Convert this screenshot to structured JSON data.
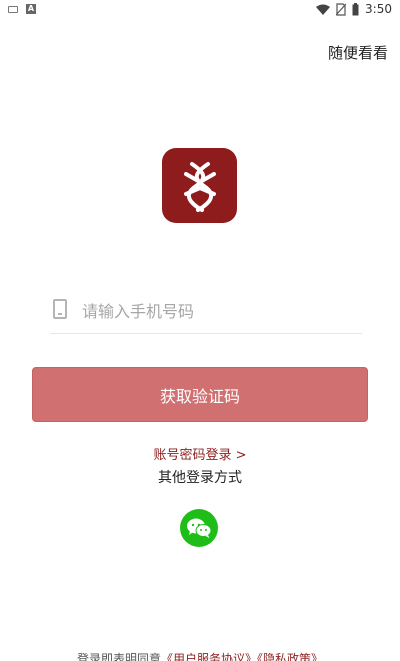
{
  "status_bar": {
    "time": "3:50",
    "icons": [
      "keyboard-icon",
      "a-icon",
      "wifi-icon",
      "no-sim-icon",
      "battery-icon"
    ],
    "a_glyph": "A"
  },
  "header": {
    "browse_link": "随便看看"
  },
  "logo": {
    "brand_color": "#8e1c1c"
  },
  "phone": {
    "placeholder": "请输入手机号码",
    "value": ""
  },
  "buttons": {
    "get_code": "获取验证码",
    "get_code_color": "#d07070"
  },
  "links": {
    "password_login": "账号密码登录",
    "password_login_arrow": ">",
    "other_methods": "其他登录方式"
  },
  "social": {
    "wechat_color": "#1fbd18"
  },
  "footer": {
    "prefix": "登录即表明同意",
    "user_agreement": "《用户服务协议》",
    "privacy_policy": "《隐私政策》"
  }
}
